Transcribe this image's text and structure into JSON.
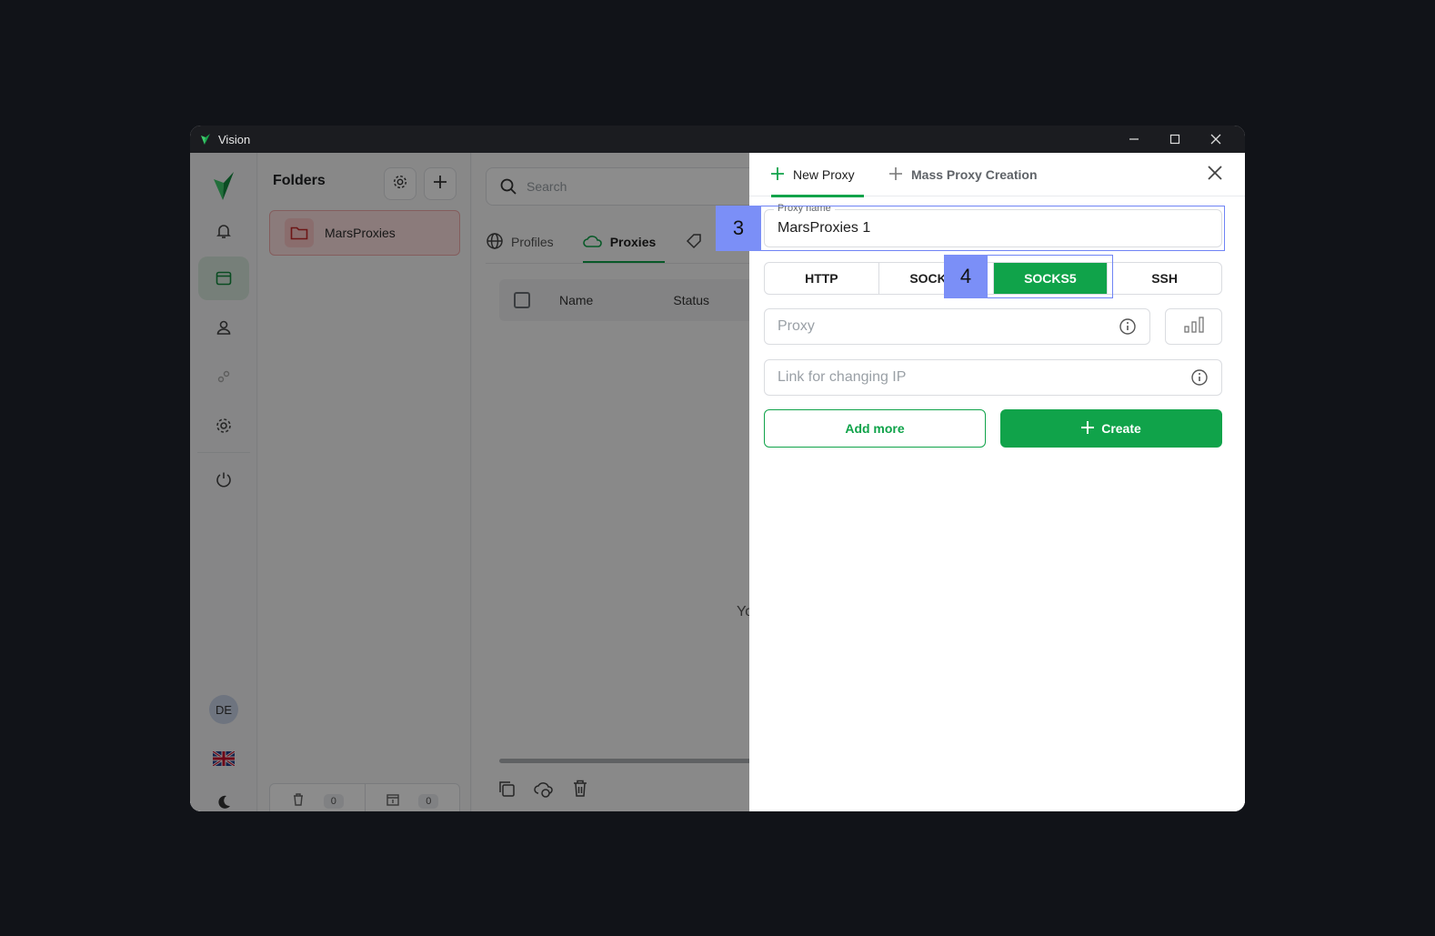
{
  "window": {
    "title": "Vision"
  },
  "rail": {
    "user_initials": "DE"
  },
  "folders": {
    "title": "Folders",
    "items": [
      {
        "label": "MarsProxies"
      }
    ],
    "bottom": {
      "trash_count": "0",
      "archive_count": "0"
    }
  },
  "main": {
    "search_placeholder": "Search",
    "tabs": [
      {
        "label": "Profiles"
      },
      {
        "label": "Proxies"
      }
    ],
    "columns": [
      "Name",
      "Status"
    ],
    "cut_text": "Yo"
  },
  "panel": {
    "tabs": [
      {
        "label": "New Proxy"
      },
      {
        "label": "Mass Proxy Creation"
      }
    ],
    "proxy_name": {
      "legend": "Proxy name",
      "value": "MarsProxies 1"
    },
    "types": [
      "HTTP",
      "SOCKS4",
      "SOCKS5",
      "SSH"
    ],
    "selected_type": "SOCKS5",
    "proxy_placeholder": "Proxy",
    "link_placeholder": "Link for changing IP",
    "add_more": "Add more",
    "create": "Create"
  },
  "markers": [
    {
      "label": "3"
    },
    {
      "label": "4"
    }
  ],
  "colors": {
    "accent": "#10a34a",
    "marker": "#7b8ff7",
    "folder": "#fde1e1"
  }
}
